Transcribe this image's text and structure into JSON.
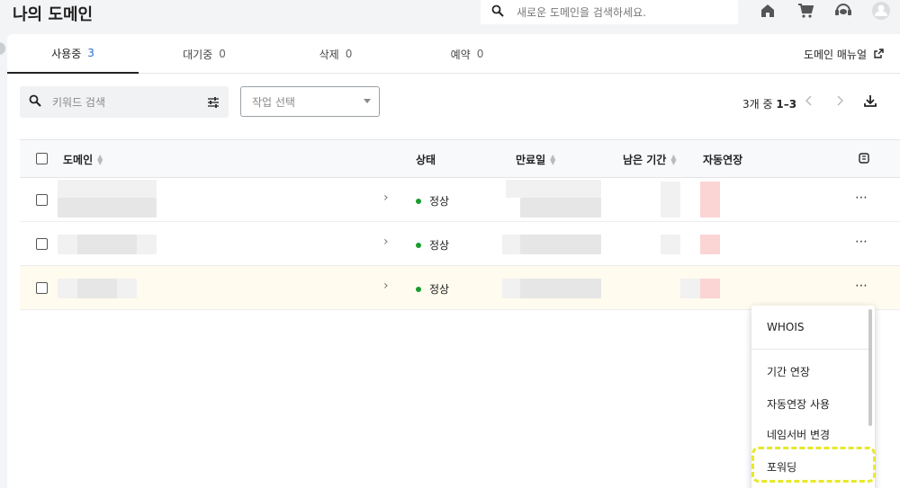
{
  "header": {
    "title": "나의 도메인",
    "search_placeholder": "새로운 도메인을 검색하세요."
  },
  "icons": {
    "search": "search-icon",
    "home": "home-icon",
    "cart": "cart-icon",
    "support": "support-icon",
    "account": "account-icon",
    "filter": "filter-icon",
    "download": "download-icon",
    "external": "external-link-icon",
    "column_settings": "column-settings-icon"
  },
  "tabs": [
    {
      "label": "사용중",
      "count": "3"
    },
    {
      "label": "대기중",
      "count": "0"
    },
    {
      "label": "삭제",
      "count": "0"
    },
    {
      "label": "예약",
      "count": "0"
    }
  ],
  "manual_link": "도메인 매뉴얼",
  "toolbar": {
    "keyword_placeholder": "키워드 검색",
    "task_select": "작업 선택",
    "pager_prefix": "3개 중 ",
    "pager_range": "1–3"
  },
  "table": {
    "columns": {
      "domain": "도메인",
      "status": "상태",
      "expiry": "만료일",
      "remaining": "남은 기간",
      "auto_renew": "자동연장"
    },
    "rows": [
      {
        "status": "정상"
      },
      {
        "status": "정상"
      },
      {
        "status": "정상"
      }
    ]
  },
  "context_menu": {
    "items": [
      "WHOIS",
      "기간 연장",
      "자동연장 사용",
      "네임서버 변경",
      "포워딩"
    ]
  },
  "colors": {
    "accent_blue": "#2f6bd8",
    "status_green": "#1a9c2e",
    "highlight_row": "#fffbee",
    "annotation_yellow": "#e8e82a"
  }
}
